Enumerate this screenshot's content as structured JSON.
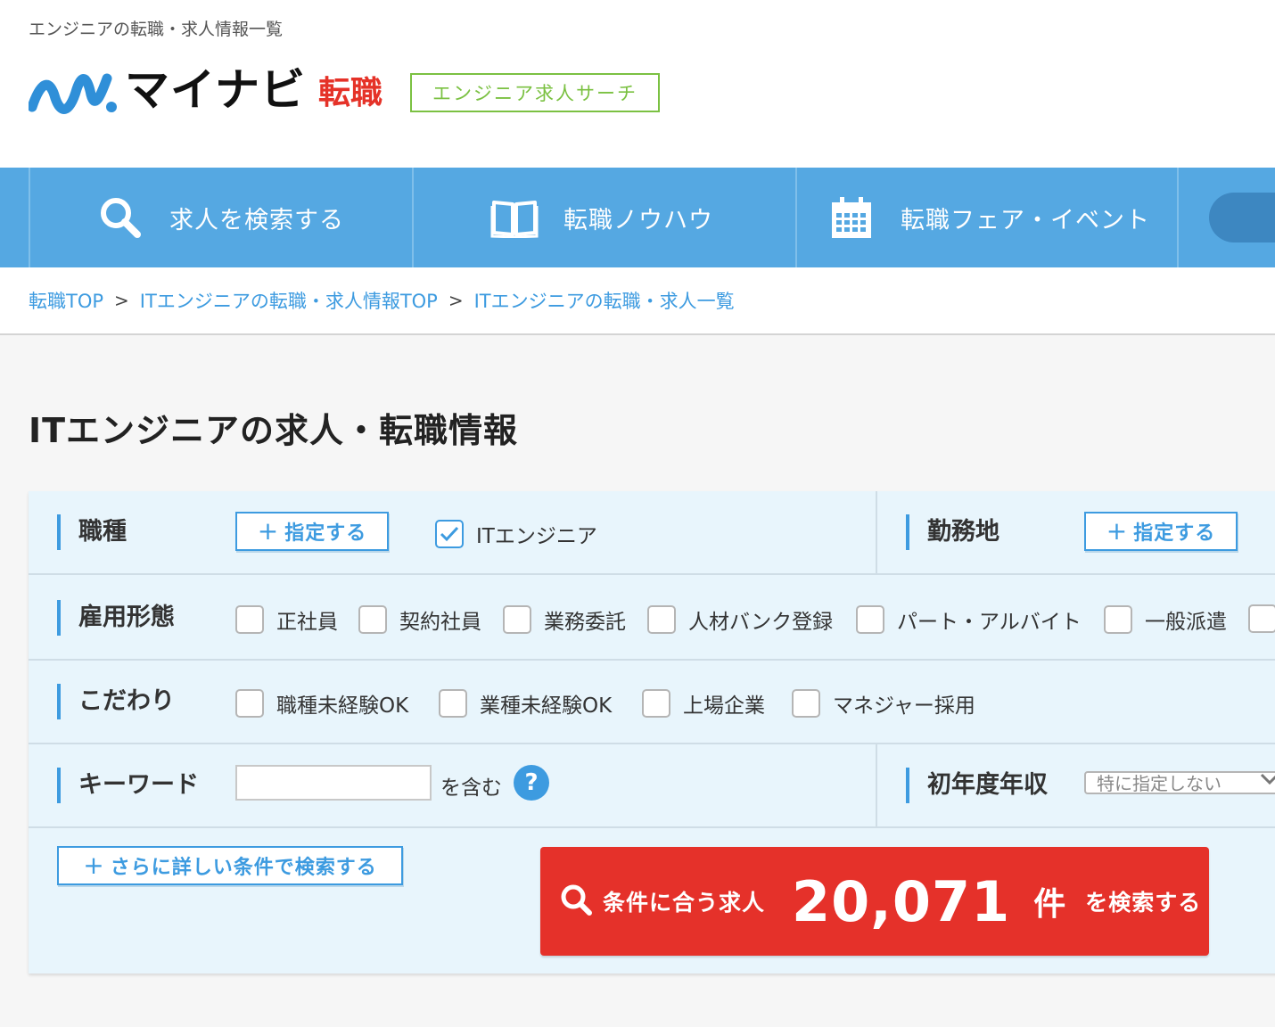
{
  "page_caption": "エンジニアの転職・求人情報一覧",
  "logo": {
    "name": "マイナビ",
    "sub": "転職",
    "badge": "エンジニア求人サーチ"
  },
  "nav": {
    "items": [
      {
        "label": "求人を検索する",
        "icon": "search-icon"
      },
      {
        "label": "転職ノウハウ",
        "icon": "book-icon"
      },
      {
        "label": "転職フェア・イベント",
        "icon": "calendar-icon"
      }
    ]
  },
  "breadcrumb": {
    "items": [
      "転職TOP",
      "ITエンジニアの転職・求人情報TOP",
      "ITエンジニアの転職・求人一覧"
    ],
    "separator": ">"
  },
  "heading": "ITエンジニアの求人・転職情報",
  "search": {
    "job_type": {
      "label": "職種",
      "button": "指定する",
      "checked_option": "ITエンジニア"
    },
    "location": {
      "label": "勤務地",
      "button": "指定する"
    },
    "employment": {
      "label": "雇用形態",
      "options": [
        "正社員",
        "契約社員",
        "業務委託",
        "人材バンク登録",
        "パート・アルバイト",
        "一般派遣"
      ]
    },
    "preferences": {
      "label": "こだわり",
      "options": [
        "職種未経験OK",
        "業種未経験OK",
        "上場企業",
        "マネジャー採用"
      ]
    },
    "keyword": {
      "label": "キーワード",
      "value": "",
      "suffix": "を含む",
      "help": "?"
    },
    "salary": {
      "label": "初年度年収",
      "selected": "特に指定しない"
    },
    "more_button": "さらに詳しい条件で検索する",
    "submit": {
      "prefix": "条件に合う求人",
      "count": "20,071",
      "unit": "件",
      "suffix": "を検索する"
    }
  },
  "colors": {
    "nav": "#55a8e2",
    "accent": "#3d9be0",
    "cta": "#e5312a",
    "brand_red": "#e53228",
    "badge_green": "#7bc142"
  }
}
